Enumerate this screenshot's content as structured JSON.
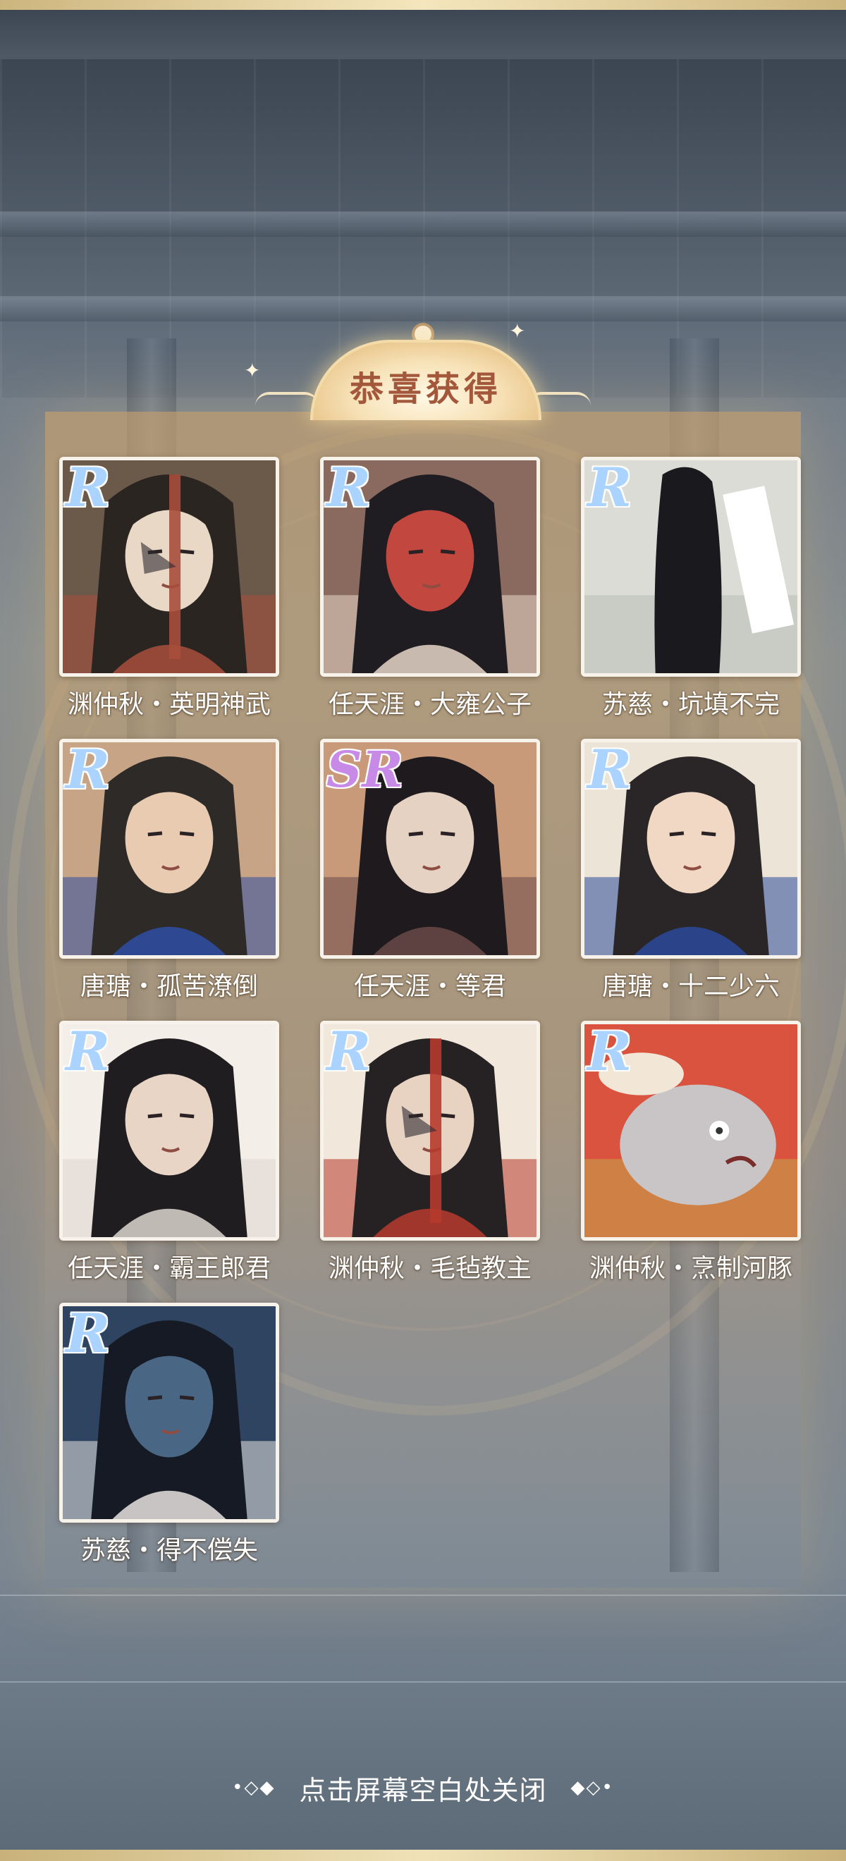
{
  "title": "恭喜获得",
  "colors": {
    "title_text": "#a3583c",
    "rarity_r": "#aad4ff",
    "rarity_sr": "#c78ae6",
    "label_text": "#ffffff",
    "card_border": "#f7f2ea"
  },
  "cards": [
    {
      "rarity": "R",
      "label": "渊仲秋・英明神武",
      "art": "portrait-scarred-red-streak",
      "art_colors": [
        "#6b5a4a",
        "#2b2522",
        "#a84e3c",
        "#e9d8c5"
      ]
    },
    {
      "rarity": "R",
      "label": "任天涯・大雍公子",
      "art": "portrait-long-black-hair",
      "art_colors": [
        "#8a6a5e",
        "#1f1c22",
        "#e8d6c8",
        "#c2473f"
      ]
    },
    {
      "rarity": "R",
      "label": "苏慈・坑填不完",
      "art": "back-view-black-hair",
      "art_colors": [
        "#dbdcd6",
        "#1a1a1e",
        "#b9bfb8",
        "#ffffff"
      ]
    },
    {
      "rarity": "R",
      "label": "唐瑭・孤苦潦倒",
      "art": "flute-player-blue-robe",
      "art_colors": [
        "#c7a486",
        "#2d2a28",
        "#2f4fa3",
        "#e8cbb0"
      ]
    },
    {
      "rarity": "SR",
      "label": "任天涯・等君",
      "art": "profile-by-window",
      "art_colors": [
        "#c99a7a",
        "#1e1a1e",
        "#6a4a48",
        "#e6d2c2"
      ]
    },
    {
      "rarity": "R",
      "label": "唐瑭・十二少六",
      "art": "smiling-blue-robe",
      "art_colors": [
        "#ece4d6",
        "#2a2628",
        "#2c4a9a",
        "#f0d8c4"
      ]
    },
    {
      "rarity": "R",
      "label": "任天涯・霸王郎君",
      "art": "profile-white-robe",
      "art_colors": [
        "#f3eee8",
        "#1f1d20",
        "#dcd6cf",
        "#e9d5c6"
      ]
    },
    {
      "rarity": "R",
      "label": "渊仲秋・毛毡教主",
      "art": "scarred-red-streak-front",
      "art_colors": [
        "#f1e7da",
        "#262224",
        "#b63a2e",
        "#e8d3c2"
      ]
    },
    {
      "rarity": "R",
      "label": "渊仲秋・烹制河豚",
      "art": "pufferfish-comic",
      "art_colors": [
        "#d9533f",
        "#c9c5c7",
        "#c7a64a",
        "#f2e7d6"
      ]
    },
    {
      "rarity": "R",
      "label": "苏慈・得不偿失",
      "art": "profile-dark-blue",
      "art_colors": [
        "#2e4460",
        "#151a24",
        "#e7e3e0",
        "#4a6685"
      ]
    }
  ],
  "close_hint": "点击屏幕空白处关闭",
  "close_deco_left": "•◇◆",
  "close_deco_right": "◆◇•"
}
